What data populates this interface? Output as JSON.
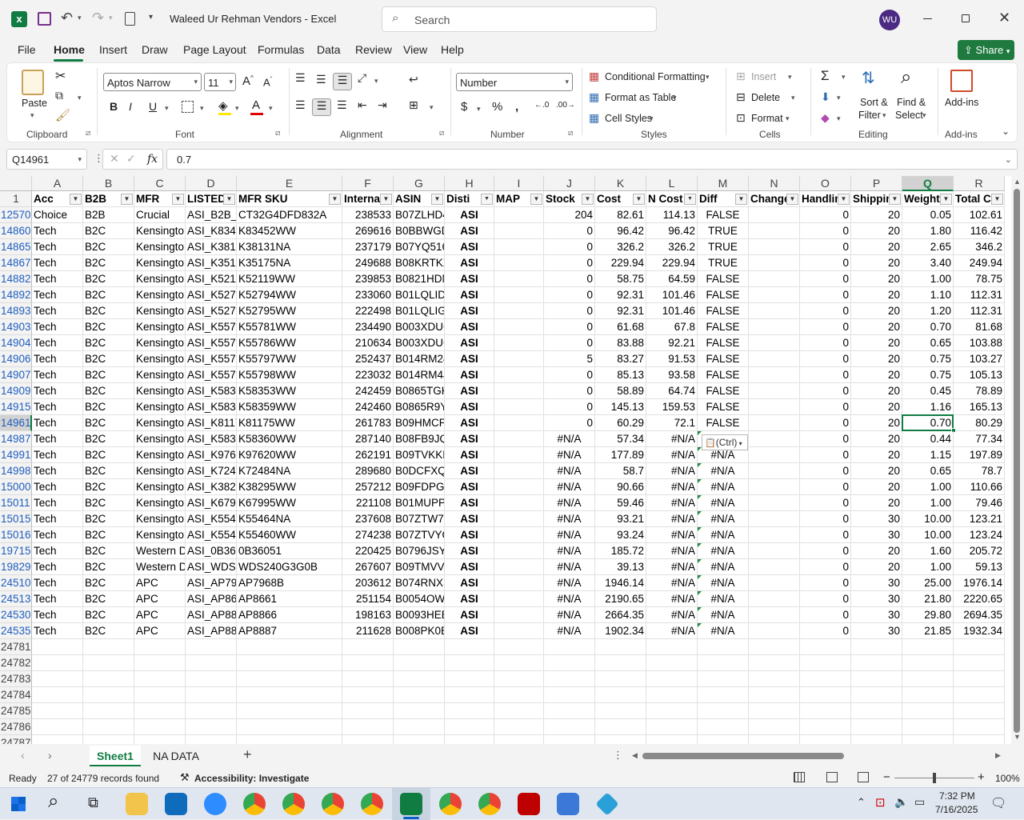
{
  "window": {
    "title": "Waleed Ur Rehman Vendors  -  Excel",
    "search_placeholder": "Search",
    "user_initials": "WU"
  },
  "ribbon_tabs": [
    "File",
    "Home",
    "Insert",
    "Draw",
    "Page Layout",
    "Formulas",
    "Data",
    "Review",
    "View",
    "Help"
  ],
  "share_label": "Share",
  "ribbon": {
    "clipboard": {
      "paste": "Paste",
      "label": "Clipboard"
    },
    "font": {
      "name": "Aptos Narrow",
      "size": "11",
      "label": "Font"
    },
    "alignment": {
      "label": "Alignment"
    },
    "number": {
      "format": "Number",
      "label": "Number"
    },
    "styles": {
      "conditional": "Conditional Formatting",
      "format_table": "Format as Table",
      "cell_styles": "Cell Styles",
      "label": "Styles"
    },
    "cells": {
      "insert": "Insert",
      "delete": "Delete",
      "format": "Format",
      "label": "Cells"
    },
    "editing": {
      "sort": "Sort &",
      "filter": "Filter",
      "find": "Find &",
      "select": "Select",
      "label": "Editing"
    },
    "addins": {
      "btn": "Add-ins",
      "label": "Add-ins"
    }
  },
  "formula_bar": {
    "name_box": "Q14961",
    "fx": "fx",
    "value": "0.7"
  },
  "columns": [
    "A",
    "B",
    "C",
    "D",
    "E",
    "F",
    "G",
    "H",
    "I",
    "J",
    "K",
    "L",
    "M",
    "N",
    "O",
    "P",
    "Q",
    "R"
  ],
  "headers": [
    "Acc",
    "B2B",
    "MFR",
    "LISTED",
    "MFR SKU",
    "Interna",
    "ASIN",
    "Disti",
    "MAP",
    "Stock",
    "Cost",
    "N Cost",
    "Diff",
    "Change",
    "Handlin",
    "Shippin",
    "Weight",
    "Total C"
  ],
  "rows": [
    {
      "n": "12570",
      "v": [
        "Choice",
        "B2B",
        "Crucial",
        "ASI_B2B_C",
        "CT32G4DFD832A",
        "238533",
        "B07ZLHD4",
        "ASI",
        "",
        "204",
        "82.61",
        "114.13",
        "FALSE",
        "",
        "0",
        "20",
        "0.05",
        "102.61"
      ]
    },
    {
      "n": "14860",
      "v": [
        "Tech",
        "B2C",
        "Kensingto",
        "ASI_K8345",
        "K83452WW",
        "269616",
        "B0BBWGD",
        "ASI",
        "",
        "0",
        "96.42",
        "96.42",
        "TRUE",
        "",
        "0",
        "20",
        "1.80",
        "116.42"
      ]
    },
    {
      "n": "14865",
      "v": [
        "Tech",
        "B2C",
        "Kensingto",
        "ASI_K3813",
        "K38131NA",
        "237179",
        "B07YQ516",
        "ASI",
        "",
        "0",
        "326.2",
        "326.2",
        "TRUE",
        "",
        "0",
        "20",
        "2.65",
        "346.2"
      ]
    },
    {
      "n": "14867",
      "v": [
        "Tech",
        "B2C",
        "Kensingto",
        "ASI_K3517",
        "K35175NA",
        "249688",
        "B08KRTKX",
        "ASI",
        "",
        "0",
        "229.94",
        "229.94",
        "TRUE",
        "",
        "0",
        "20",
        "3.40",
        "249.94"
      ]
    },
    {
      "n": "14882",
      "v": [
        "Tech",
        "B2C",
        "Kensingto",
        "ASI_K5211",
        "K52119WW",
        "239853",
        "B0821HDN",
        "ASI",
        "",
        "0",
        "58.75",
        "64.59",
        "FALSE",
        "",
        "0",
        "20",
        "1.00",
        "78.75"
      ]
    },
    {
      "n": "14892",
      "v": [
        "Tech",
        "B2C",
        "Kensingto",
        "ASI_K5279",
        "K52794WW",
        "233060",
        "B01LQLID7",
        "ASI",
        "",
        "0",
        "92.31",
        "101.46",
        "FALSE",
        "",
        "0",
        "20",
        "1.10",
        "112.31"
      ]
    },
    {
      "n": "14893",
      "v": [
        "Tech",
        "B2C",
        "Kensingto",
        "ASI_K5279",
        "K52795WW",
        "222498",
        "B01LQLIGV",
        "ASI",
        "",
        "0",
        "92.31",
        "101.46",
        "FALSE",
        "",
        "0",
        "20",
        "1.20",
        "112.31"
      ]
    },
    {
      "n": "14903",
      "v": [
        "Tech",
        "B2C",
        "Kensingto",
        "ASI_K5578",
        "K55781WW",
        "234490",
        "B003XDUC",
        "ASI",
        "",
        "0",
        "61.68",
        "67.8",
        "FALSE",
        "",
        "0",
        "20",
        "0.70",
        "81.68"
      ]
    },
    {
      "n": "14904",
      "v": [
        "Tech",
        "B2C",
        "Kensingto",
        "ASI_K5578",
        "K55786WW",
        "210634",
        "B003XDUC",
        "ASI",
        "",
        "0",
        "83.88",
        "92.21",
        "FALSE",
        "",
        "0",
        "20",
        "0.65",
        "103.88"
      ]
    },
    {
      "n": "14906",
      "v": [
        "Tech",
        "B2C",
        "Kensingto",
        "ASI_K5579",
        "K55797WW",
        "252437",
        "B014RM24",
        "ASI",
        "",
        "5",
        "83.27",
        "91.53",
        "FALSE",
        "",
        "0",
        "20",
        "0.75",
        "103.27"
      ]
    },
    {
      "n": "14907",
      "v": [
        "Tech",
        "B2C",
        "Kensingto",
        "ASI_K5579",
        "K55798WW",
        "223032",
        "B014RM4J",
        "ASI",
        "",
        "0",
        "85.13",
        "93.58",
        "FALSE",
        "",
        "0",
        "20",
        "0.75",
        "105.13"
      ]
    },
    {
      "n": "14909",
      "v": [
        "Tech",
        "B2C",
        "Kensingto",
        "ASI_K5835",
        "K58353WW",
        "242459",
        "B0865TGK",
        "ASI",
        "",
        "0",
        "58.89",
        "64.74",
        "FALSE",
        "",
        "0",
        "20",
        "0.45",
        "78.89"
      ]
    },
    {
      "n": "14915",
      "v": [
        "Tech",
        "B2C",
        "Kensingto",
        "ASI_K5835",
        "K58359WW",
        "242460",
        "B0865R9Y",
        "ASI",
        "",
        "0",
        "145.13",
        "159.53",
        "FALSE",
        "",
        "0",
        "20",
        "1.16",
        "165.13"
      ]
    },
    {
      "n": "14961",
      "v": [
        "Tech",
        "B2C",
        "Kensingto",
        "ASI_K8117",
        "K81175WW",
        "261783",
        "B09HMCP",
        "ASI",
        "",
        "0",
        "60.29",
        "72.1",
        "FALSE",
        "",
        "0",
        "20",
        "0.70",
        "80.29"
      ]
    },
    {
      "n": "14987",
      "v": [
        "Tech",
        "B2C",
        "Kensingto",
        "ASI_K5836",
        "K58360WW",
        "287140",
        "B08FB9JQ",
        "ASI",
        "",
        "#N/A",
        "57.34",
        "#N/A",
        "#N/A",
        "",
        "0",
        "20",
        "0.44",
        "77.34"
      ]
    },
    {
      "n": "14991",
      "v": [
        "Tech",
        "B2C",
        "Kensingto",
        "ASI_K9762",
        "K97620WW",
        "262191",
        "B09TVKKF",
        "ASI",
        "",
        "#N/A",
        "177.89",
        "#N/A",
        "#N/A",
        "",
        "0",
        "20",
        "1.15",
        "197.89"
      ]
    },
    {
      "n": "14998",
      "v": [
        "Tech",
        "B2C",
        "Kensingto",
        "ASI_K7248",
        "K72484NA",
        "289680",
        "B0DCFXQ",
        "ASI",
        "",
        "#N/A",
        "58.7",
        "#N/A",
        "#N/A",
        "",
        "0",
        "20",
        "0.65",
        "78.7"
      ]
    },
    {
      "n": "15000",
      "v": [
        "Tech",
        "B2C",
        "Kensingto",
        "ASI_K3829",
        "K38295WW",
        "257212",
        "B09FDPG4",
        "ASI",
        "",
        "#N/A",
        "90.66",
        "#N/A",
        "#N/A",
        "",
        "0",
        "20",
        "1.00",
        "110.66"
      ]
    },
    {
      "n": "15011",
      "v": [
        "Tech",
        "B2C",
        "Kensingto",
        "ASI_K6799",
        "K67995WW",
        "221108",
        "B01MUPP",
        "ASI",
        "",
        "#N/A",
        "59.46",
        "#N/A",
        "#N/A",
        "",
        "0",
        "20",
        "1.00",
        "79.46"
      ]
    },
    {
      "n": "15015",
      "v": [
        "Tech",
        "B2C",
        "Kensingto",
        "ASI_K5546",
        "K55464NA",
        "237608",
        "B07ZTW7Y",
        "ASI",
        "",
        "#N/A",
        "93.21",
        "#N/A",
        "#N/A",
        "",
        "0",
        "30",
        "10.00",
        "123.21"
      ]
    },
    {
      "n": "15016",
      "v": [
        "Tech",
        "B2C",
        "Kensingto",
        "ASI_K5546",
        "K55460WW",
        "274238",
        "B07ZTVYQ",
        "ASI",
        "",
        "#N/A",
        "93.24",
        "#N/A",
        "#N/A",
        "",
        "0",
        "30",
        "10.00",
        "123.24"
      ]
    },
    {
      "n": "19715",
      "v": [
        "Tech",
        "B2C",
        "Western D",
        "ASI_0B360",
        "0B36051",
        "220425",
        "B0796JSY3",
        "ASI",
        "",
        "#N/A",
        "185.72",
        "#N/A",
        "#N/A",
        "",
        "0",
        "20",
        "1.60",
        "205.72"
      ]
    },
    {
      "n": "19829",
      "v": [
        "Tech",
        "B2C",
        "Western D",
        "ASI_WDS2",
        "WDS240G3G0B",
        "267607",
        "B09TMVV6",
        "ASI",
        "",
        "#N/A",
        "39.13",
        "#N/A",
        "#N/A",
        "",
        "0",
        "20",
        "1.00",
        "59.13"
      ]
    },
    {
      "n": "24510",
      "v": [
        "Tech",
        "B2C",
        "APC",
        "ASI_AP796",
        "AP7968B",
        "203612",
        "B074RNXS",
        "ASI",
        "",
        "#N/A",
        "1946.14",
        "#N/A",
        "#N/A",
        "",
        "0",
        "30",
        "25.00",
        "1976.14"
      ]
    },
    {
      "n": "24513",
      "v": [
        "Tech",
        "B2C",
        "APC",
        "ASI_AP866",
        "AP8661",
        "251154",
        "B0054OW",
        "ASI",
        "",
        "#N/A",
        "2190.65",
        "#N/A",
        "#N/A",
        "",
        "0",
        "30",
        "21.80",
        "2220.65"
      ]
    },
    {
      "n": "24530",
      "v": [
        "Tech",
        "B2C",
        "APC",
        "ASI_AP886",
        "AP8866",
        "198163",
        "B0093HEB",
        "ASI",
        "",
        "#N/A",
        "2664.35",
        "#N/A",
        "#N/A",
        "",
        "0",
        "30",
        "29.80",
        "2694.35"
      ]
    },
    {
      "n": "24535",
      "v": [
        "Tech",
        "B2C",
        "APC",
        "ASI_AP888",
        "AP8887",
        "211628",
        "B008PK0B",
        "ASI",
        "",
        "#N/A",
        "1902.34",
        "#N/A",
        "#N/A",
        "",
        "0",
        "30",
        "21.85",
        "1932.34"
      ]
    }
  ],
  "empty_rows": [
    "24781",
    "24782",
    "24783",
    "24784",
    "24785",
    "24786",
    "24787"
  ],
  "paste_ctrl": "(Ctrl)",
  "sheets": [
    "Sheet1",
    "NA DATA"
  ],
  "status": {
    "ready": "Ready",
    "records": "27 of 24779 records found",
    "accessibility": "Accessibility: Investigate",
    "zoom": "100%"
  },
  "clock": {
    "time": "7:32 PM",
    "date": "7/16/2025"
  },
  "colors": {
    "excel_green": "#107c41",
    "share_green": "#1f7a3f",
    "link_blue": "#1f5fbf",
    "selection": "#107c41"
  }
}
